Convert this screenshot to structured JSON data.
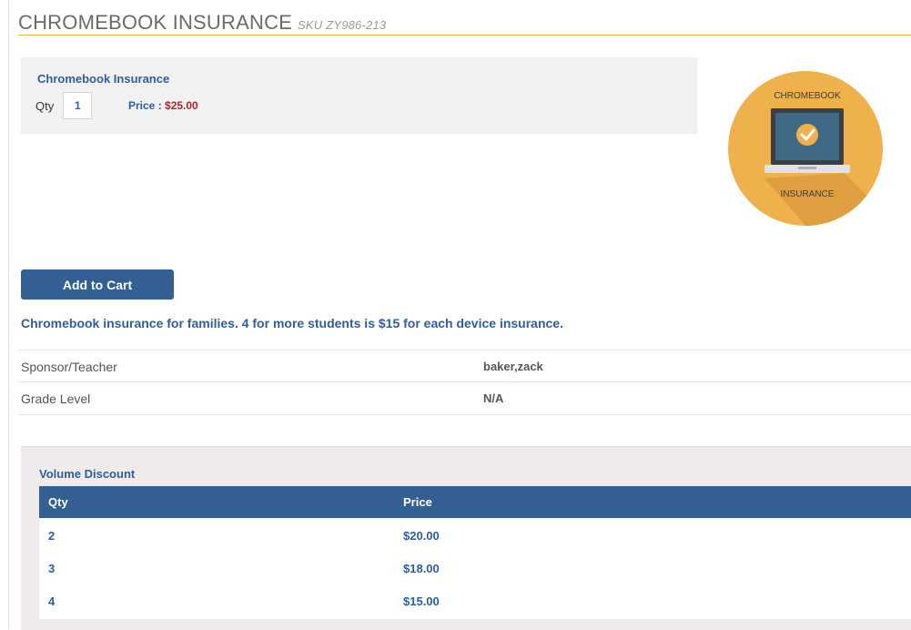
{
  "header": {
    "title": "CHROMEBOOK INSURANCE",
    "sku": "SKU ZY986-213"
  },
  "option": {
    "name": "Chromebook Insurance",
    "qty_label": "Qty",
    "qty_value": "1",
    "price_label": "Price :",
    "price_value": "$25.00"
  },
  "product_image": {
    "top_text": "CHROMEBOOK",
    "bottom_text": "INSURANCE",
    "colors": {
      "circle": "#efb14c",
      "laptop": "#3f6985",
      "base": "#dfe3e6",
      "check": "#efb14c"
    }
  },
  "cart": {
    "add_label": "Add to Cart"
  },
  "description": "Chromebook insurance for families. 4 for more students is $15 for each device insurance.",
  "details": [
    {
      "label": "Sponsor/Teacher",
      "value": "baker,zack"
    },
    {
      "label": "Grade Level",
      "value": "N/A"
    }
  ],
  "volume_discount": {
    "title": "Volume Discount",
    "columns": [
      "Qty",
      "Price"
    ],
    "rows": [
      {
        "qty": "2",
        "price": "$20.00"
      },
      {
        "qty": "3",
        "price": "$18.00"
      },
      {
        "qty": "4",
        "price": "$15.00"
      }
    ]
  },
  "colors": {
    "accent": "#f0b54a",
    "link_blue": "#2e5e9e",
    "button_blue": "#335f93",
    "price_red": "#b3262d"
  }
}
